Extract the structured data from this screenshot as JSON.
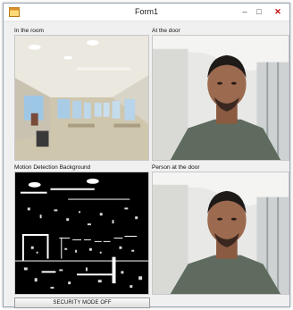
{
  "window": {
    "title": "Form1",
    "minimize_glyph": "–",
    "maximize_glyph": "□",
    "close_glyph": "✕",
    "icon": "app-window-icon"
  },
  "panels": {
    "room": {
      "label": "In the room"
    },
    "door": {
      "label": "At the door"
    },
    "motion": {
      "label": "Motion Detection Background"
    },
    "person": {
      "label": "Person at the door"
    }
  },
  "controls": {
    "security_button_label": "SECURITY MODE OFF"
  },
  "colors": {
    "titlebar": "#ffffff",
    "form_background": "#f0f0f0",
    "close_button": "#c00000"
  }
}
